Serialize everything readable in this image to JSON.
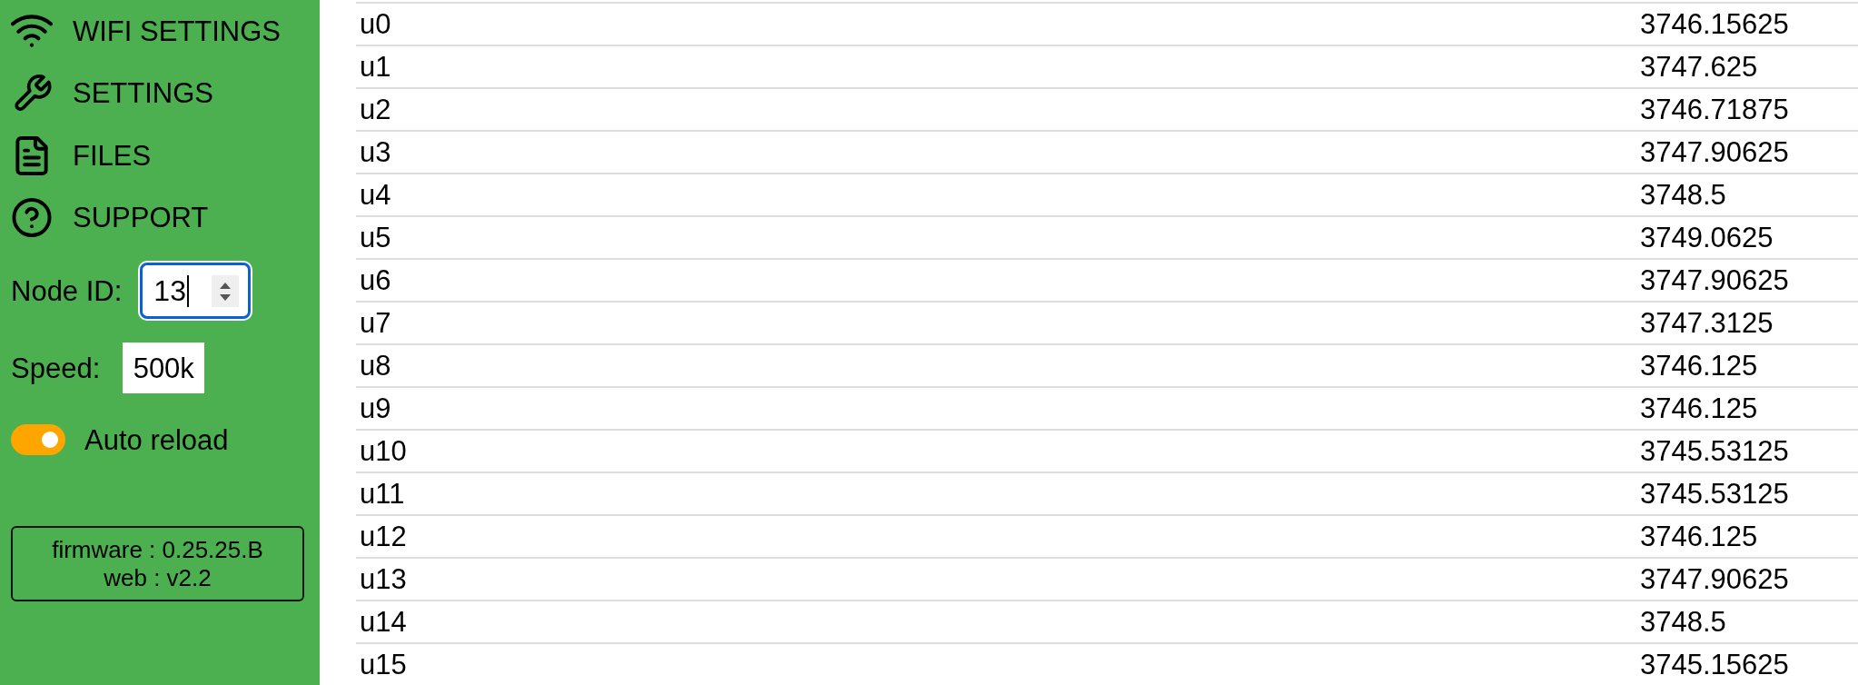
{
  "sidebar": {
    "nav_items": [
      {
        "label": "WIFI SETTINGS"
      },
      {
        "label": "SETTINGS"
      },
      {
        "label": "FILES"
      },
      {
        "label": "SUPPORT"
      }
    ],
    "node_id": {
      "label": "Node ID:",
      "value": "13",
      "focused": true
    },
    "speed": {
      "label": "Speed:",
      "value": "500k"
    },
    "auto_reload": {
      "label": "Auto reload",
      "on": true
    },
    "version_info": {
      "lines": [
        "firmware : 0.25.25.B",
        "web : v2.2"
      ]
    }
  },
  "table": {
    "rows": [
      {
        "name": "u0",
        "value": "3746.15625"
      },
      {
        "name": "u1",
        "value": "3747.625"
      },
      {
        "name": "u2",
        "value": "3746.71875"
      },
      {
        "name": "u3",
        "value": "3747.90625"
      },
      {
        "name": "u4",
        "value": "3748.5"
      },
      {
        "name": "u5",
        "value": "3749.0625"
      },
      {
        "name": "u6",
        "value": "3747.90625"
      },
      {
        "name": "u7",
        "value": "3747.3125"
      },
      {
        "name": "u8",
        "value": "3746.125"
      },
      {
        "name": "u9",
        "value": "3746.125"
      },
      {
        "name": "u10",
        "value": "3745.53125"
      },
      {
        "name": "u11",
        "value": "3745.53125"
      },
      {
        "name": "u12",
        "value": "3746.125"
      },
      {
        "name": "u13",
        "value": "3747.90625"
      },
      {
        "name": "u14",
        "value": "3748.5"
      },
      {
        "name": "u15",
        "value": "3745.15625"
      }
    ]
  }
}
